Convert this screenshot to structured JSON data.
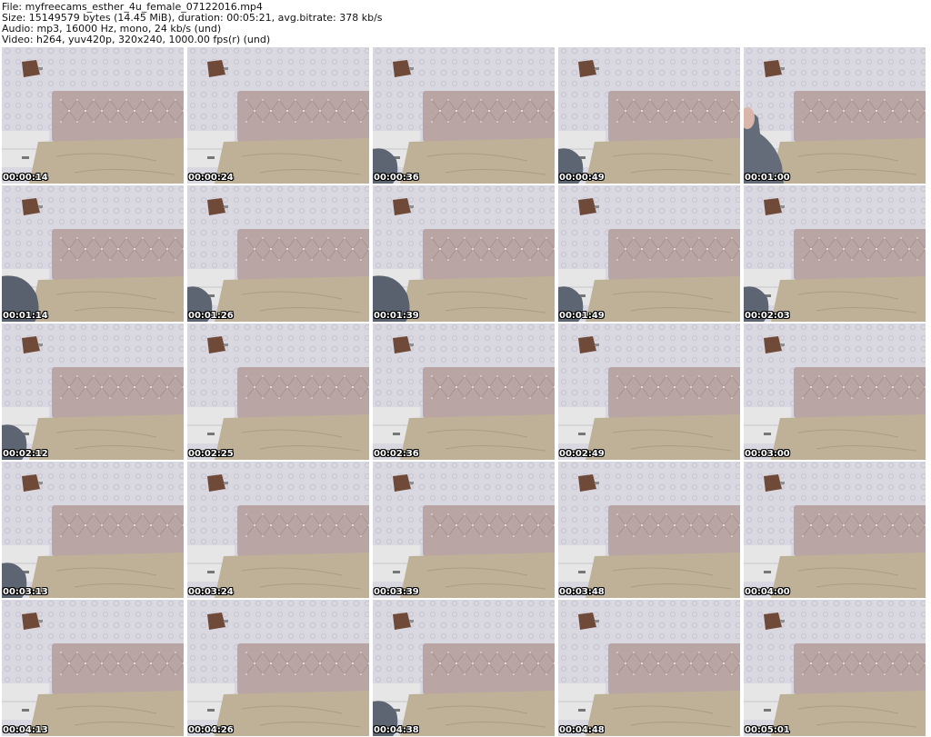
{
  "header": {
    "file": "File: myfreecams_esther_4u_female_07122016.mp4",
    "size": "Size: 15149579 bytes (14.45 MiB), duration: 00:05:21, avg.bitrate: 378 kb/s",
    "audio": "Audio: mp3, 16000 Hz, mono, 24 kb/s (und)",
    "video": "Video: h264, yuv420p, 320x240, 1000.00 fps(r) (und)"
  },
  "thumbnails": [
    {
      "timestamp": "00:00:14",
      "person": "none"
    },
    {
      "timestamp": "00:00:24",
      "person": "none"
    },
    {
      "timestamp": "00:00:36",
      "person": "left-small"
    },
    {
      "timestamp": "00:00:49",
      "person": "left-small"
    },
    {
      "timestamp": "00:01:00",
      "person": "left-large"
    },
    {
      "timestamp": "00:01:14",
      "person": "left-medium"
    },
    {
      "timestamp": "00:01:26",
      "person": "left-small"
    },
    {
      "timestamp": "00:01:39",
      "person": "left-medium"
    },
    {
      "timestamp": "00:01:49",
      "person": "left-small"
    },
    {
      "timestamp": "00:02:03",
      "person": "left-small"
    },
    {
      "timestamp": "00:02:12",
      "person": "left-small"
    },
    {
      "timestamp": "00:02:25",
      "person": "none"
    },
    {
      "timestamp": "00:02:36",
      "person": "none"
    },
    {
      "timestamp": "00:02:49",
      "person": "none"
    },
    {
      "timestamp": "00:03:00",
      "person": "none"
    },
    {
      "timestamp": "00:03:13",
      "person": "left-small"
    },
    {
      "timestamp": "00:03:24",
      "person": "none"
    },
    {
      "timestamp": "00:03:39",
      "person": "none"
    },
    {
      "timestamp": "00:03:48",
      "person": "none"
    },
    {
      "timestamp": "00:04:00",
      "person": "none"
    },
    {
      "timestamp": "00:04:13",
      "person": "none"
    },
    {
      "timestamp": "00:04:26",
      "person": "none"
    },
    {
      "timestamp": "00:04:38",
      "person": "left-small"
    },
    {
      "timestamp": "00:04:48",
      "person": "none"
    },
    {
      "timestamp": "00:05:01",
      "person": "none"
    }
  ],
  "colors": {
    "wallpaper": "#d9d7e0",
    "headboard": "#b9a5a3",
    "bedsheet": "#bfb197",
    "nightstand": "#e7e6e6",
    "lamp": "#6f4a38"
  }
}
